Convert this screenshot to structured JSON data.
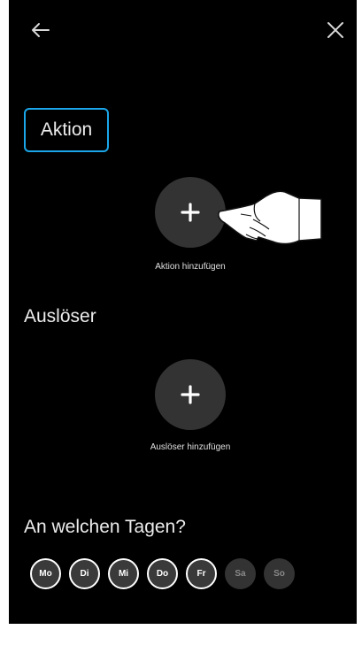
{
  "header": {
    "back_icon": "arrow-left-icon",
    "close_icon": "close-icon"
  },
  "action_section": {
    "title": "Aktion",
    "add_label": "Aktion hinzufügen",
    "add_icon": "plus-icon"
  },
  "trigger_section": {
    "title": "Auslöser",
    "add_label": "Auslöser hinzufügen",
    "add_icon": "plus-icon"
  },
  "days_section": {
    "title": "An welchen Tagen?",
    "days": [
      {
        "label": "Mo",
        "selected": true
      },
      {
        "label": "Di",
        "selected": true
      },
      {
        "label": "Mi",
        "selected": true
      },
      {
        "label": "Do",
        "selected": true
      },
      {
        "label": "Fr",
        "selected": true
      },
      {
        "label": "Sa",
        "selected": false
      },
      {
        "label": "So",
        "selected": false
      }
    ]
  },
  "overlay": {
    "pointer_icon": "pointing-hand-icon"
  },
  "colors": {
    "background": "#000000",
    "accent": "#1aa6e8",
    "circle": "#333333"
  }
}
